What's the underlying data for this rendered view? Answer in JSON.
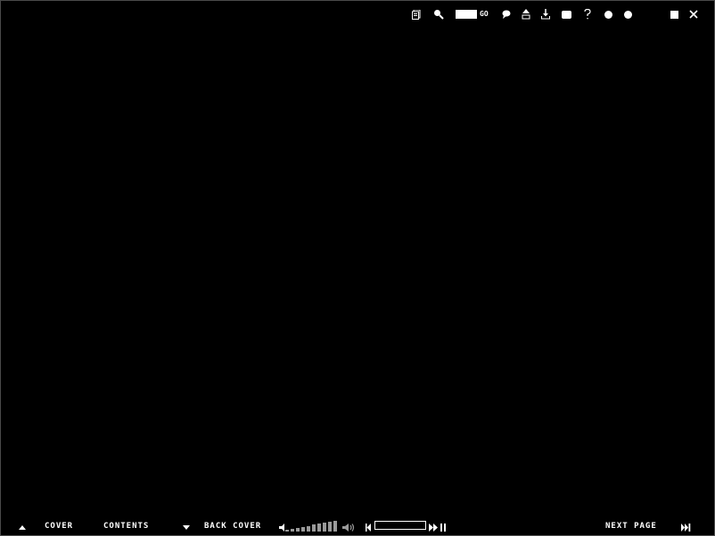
{
  "window": {
    "maximize_icon": "square-icon",
    "close_icon": "close-icon"
  },
  "toolbar_top": {
    "page_input_value": "",
    "go_label": "GO",
    "icons": [
      "document-icon",
      "zoom-icon",
      "comment-icon",
      "bookmark-icon",
      "download-icon",
      "print-icon",
      "help-icon",
      "circle-icon",
      "circle-icon"
    ]
  },
  "toolbar_bottom": {
    "cover_label": "COVER",
    "contents_label": "CONTENTS",
    "back_cover_label": "BACK COVER",
    "next_page_label": "NEXT PAGE",
    "volume_level": 1.0,
    "playback_progress": 0.0
  },
  "colors": {
    "background": "#000000",
    "foreground": "#ffffff",
    "volume_bar": "#9a9a9a"
  }
}
